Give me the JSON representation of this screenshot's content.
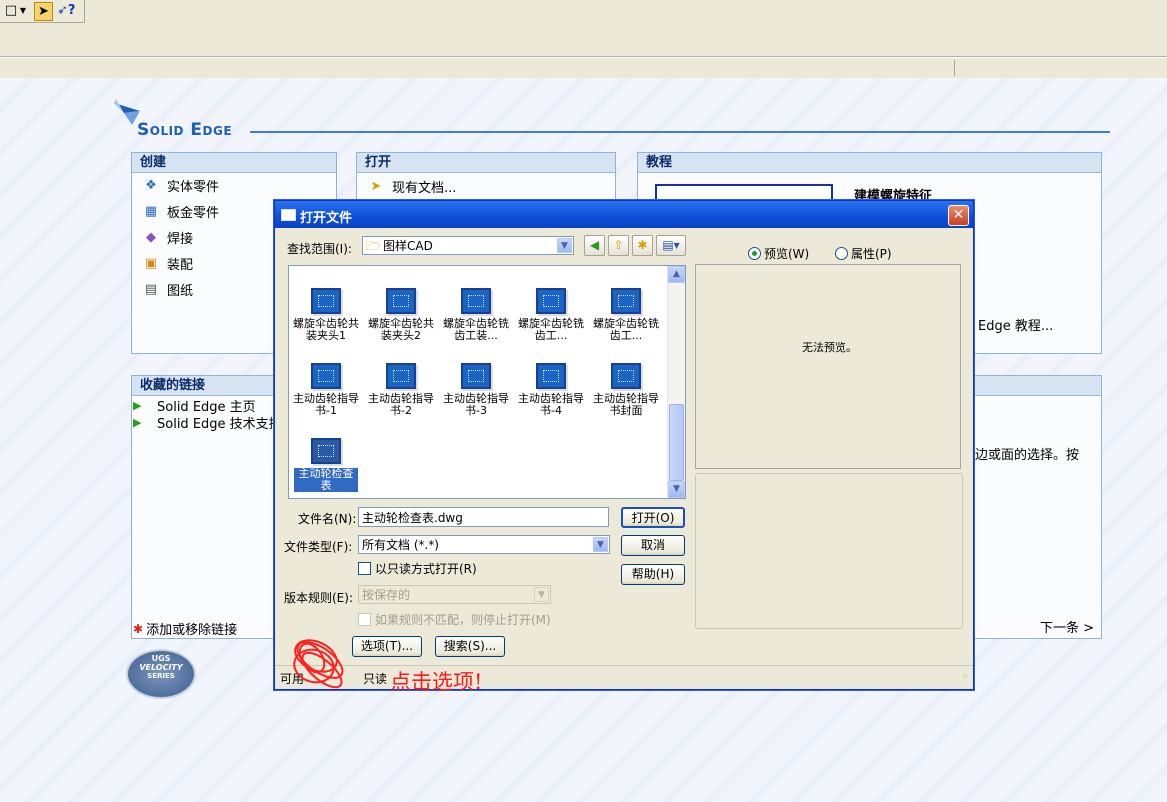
{
  "toolbar": {
    "icons": [
      "new-doc-icon",
      "dropdown-icon",
      "open-folder-icon",
      "help-icon"
    ]
  },
  "brand": {
    "logo_text": "Solid Edge",
    "accent": "#1f5fb4"
  },
  "panels": {
    "create": {
      "title": "创建",
      "items": [
        {
          "label": "实体零件",
          "icon": "part-icon"
        },
        {
          "label": "板金零件",
          "icon": "sheetmetal-icon"
        },
        {
          "label": "焊接",
          "icon": "weld-icon"
        },
        {
          "label": "装配",
          "icon": "assembly-icon"
        },
        {
          "label": "图纸",
          "icon": "drawing-icon"
        }
      ]
    },
    "open": {
      "title": "打开",
      "items": [
        {
          "label": "现有文档..."
        }
      ]
    },
    "tutorial": {
      "title": "教程",
      "topic": "建模螺旋特征",
      "link_tail": "Edge 教程...",
      "desc_tail": "边或面的选择。按",
      "next": "下一条 >"
    },
    "favorites": {
      "title": "收藏的链接",
      "items": [
        {
          "label": "Solid Edge 主页"
        },
        {
          "label": "Solid Edge 技术支持"
        }
      ],
      "add_remove": "添加或移除链接"
    }
  },
  "ugs_logo": {
    "top": "UGS",
    "middle": "VELOCITY",
    "bottom": "SERIES"
  },
  "dialog": {
    "title": "打开文件",
    "lookin_label": "查找范围(I):",
    "lookin_value": "图样CAD",
    "files": [
      {
        "label": "螺旋伞齿轮共装夹头1"
      },
      {
        "label": "螺旋伞齿轮共装夹头2"
      },
      {
        "label": "螺旋伞齿轮铣齿工装..."
      },
      {
        "label": "螺旋伞齿轮铣齿工..."
      },
      {
        "label": "螺旋伞齿轮铣齿工..."
      },
      {
        "label": "主动齿轮指导书-1"
      },
      {
        "label": "主动齿轮指导书-2"
      },
      {
        "label": "主动齿轮指导书-3"
      },
      {
        "label": "主动齿轮指导书-4"
      },
      {
        "label": "主动齿轮指导书封面"
      },
      {
        "label": "主动轮检查表"
      }
    ],
    "filename_label": "文件名(N):",
    "filename_value": "主动轮检查表.dwg",
    "filetype_label": "文件类型(F):",
    "filetype_value": "所有文档 (*.*)",
    "readonly_label": "以只读方式打开(R)",
    "version_label": "版本规则(E):",
    "version_value": "按保存的",
    "version_check_label": "如果规则不匹配，则停止打开(M)",
    "open_button": "打开(O)",
    "cancel_button": "取消",
    "help_button": "帮助(H)",
    "options_button": "选项(T)...",
    "search_button": "搜索(S)...",
    "preview_radio": "预览(W)",
    "props_radio": "属性(P)",
    "no_preview": "无法预览。",
    "status_left": "可用",
    "status_right": "只读"
  },
  "annotation": {
    "text": "点击选项!",
    "color": "#ff1a1a"
  }
}
